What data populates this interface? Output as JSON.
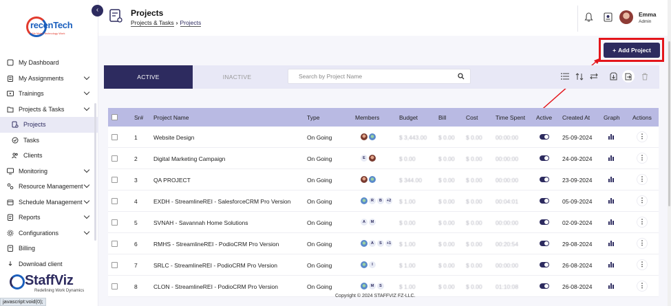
{
  "brand": {
    "logo_text": "recenTech",
    "logo_tagline": "We Make Technology Work"
  },
  "sidebar": {
    "items": [
      {
        "label": "My Dashboard",
        "icon": "grid-icon",
        "chevron": false
      },
      {
        "label": "My Assignments",
        "icon": "clipboard-icon",
        "chevron": true
      },
      {
        "label": "Trainings",
        "icon": "play-icon",
        "chevron": true
      },
      {
        "label": "Projects & Tasks",
        "icon": "folder-icon",
        "chevron": true
      },
      {
        "label": "Projects",
        "icon": "project-icon",
        "chevron": false,
        "sub": true,
        "active": true
      },
      {
        "label": "Tasks",
        "icon": "check-circle-icon",
        "chevron": false,
        "sub": true
      },
      {
        "label": "Clients",
        "icon": "users-icon",
        "chevron": false,
        "sub": true
      },
      {
        "label": "Monitoring",
        "icon": "monitor-icon",
        "chevron": true
      },
      {
        "label": "Resource Management",
        "icon": "resource-icon",
        "chevron": true
      },
      {
        "label": "Schedule Management",
        "icon": "calendar-icon",
        "chevron": true
      },
      {
        "label": "Reports",
        "icon": "report-icon",
        "chevron": true
      },
      {
        "label": "Configurations",
        "icon": "gear-icon",
        "chevron": true
      },
      {
        "label": "Billing",
        "icon": "billing-icon",
        "chevron": false
      },
      {
        "label": "Download client",
        "icon": "download-icon",
        "chevron": false
      }
    ],
    "footer_brand": "StaffViz",
    "footer_tagline": "Redefining Work Dynamics",
    "status_text": "javascript:void(0);"
  },
  "header": {
    "title": "Projects",
    "breadcrumb": [
      "Projects & Tasks",
      "Projects"
    ],
    "user_name": "Emma",
    "user_role": "Admin"
  },
  "actions": {
    "add_project": "Add Project"
  },
  "tabs": {
    "active": "ACTIVE",
    "inactive": "INACTIVE"
  },
  "search": {
    "placeholder": "Search by Project Name",
    "value": ""
  },
  "table": {
    "headers": [
      "Sr#",
      "Project Name",
      "Type",
      "Members",
      "Budget",
      "Bill",
      "Cost",
      "Time Spent",
      "Active",
      "Created At",
      "Graph",
      "Actions"
    ],
    "rows": [
      {
        "sr": "1",
        "name": "Website Design",
        "type": "On Going",
        "members": [
          "photo",
          "pic"
        ],
        "budget": "$ 3,443.00",
        "bill": "$ 0.00",
        "cost": "$ 0.00",
        "time": "00:00:00",
        "active": true,
        "created": "25-09-2024"
      },
      {
        "sr": "2",
        "name": "Digital Marketing Campaign",
        "type": "On Going",
        "members": [
          "E",
          "photo"
        ],
        "budget": "$ 0.00",
        "bill": "$ 0.00",
        "cost": "$ 0.00",
        "time": "00:00:00",
        "active": true,
        "created": "24-09-2024"
      },
      {
        "sr": "3",
        "name": "QA PROJECT",
        "type": "On Going",
        "members": [
          "photo",
          "pic"
        ],
        "budget": "$ 344.00",
        "bill": "$ 0.00",
        "cost": "$ 0.00",
        "time": "00:00:00",
        "active": true,
        "created": "23-09-2024"
      },
      {
        "sr": "4",
        "name": "EXDH - StreamlineREI - SalesforceCRM Pro Version",
        "type": "On Going",
        "members": [
          "pic",
          "R",
          "B",
          "+2"
        ],
        "budget": "$ 1.00",
        "bill": "$ 0.00",
        "cost": "$ 0.00",
        "time": "00:04:01",
        "active": true,
        "created": "05-09-2024"
      },
      {
        "sr": "5",
        "name": "SVNAH - Savannah Home Solutions",
        "type": "On Going",
        "members": [
          "A",
          "M"
        ],
        "budget": "$ 0.00",
        "bill": "$ 0.00",
        "cost": "$ 0.00",
        "time": "00:00:00",
        "active": true,
        "created": "02-09-2024"
      },
      {
        "sr": "6",
        "name": "RMHS - StreamlineREI - PodioCRM Pro Version",
        "type": "On Going",
        "members": [
          "pic",
          "A",
          "S",
          "+1"
        ],
        "budget": "$ 1.00",
        "bill": "$ 0.00",
        "cost": "$ 0.00",
        "time": "00:20:54",
        "active": true,
        "created": "29-08-2024"
      },
      {
        "sr": "7",
        "name": "SRLC - StreamlineREI - PodioCRM Pro Version",
        "type": "On Going",
        "members": [
          "pic",
          "I"
        ],
        "budget": "$ 1.00",
        "bill": "$ 0.00",
        "cost": "$ 0.00",
        "time": "00:00:00",
        "active": true,
        "created": "26-08-2024"
      },
      {
        "sr": "8",
        "name": "CLON - StreamlineREI - PodioCRM Pro Version",
        "type": "On Going",
        "members": [
          "pic",
          "M",
          "S"
        ],
        "budget": "$ 1.00",
        "bill": "$ 0.00",
        "cost": "$ 0.00",
        "time": "01:10:08",
        "active": true,
        "created": "26-08-2024"
      }
    ]
  },
  "footer": {
    "copyright": "Copyright © 2024 STAFFVIZ FZ-LLC."
  },
  "colors": {
    "primary": "#2d2b5f",
    "table_header": "#b9bae3",
    "highlight": "#e4151b"
  }
}
